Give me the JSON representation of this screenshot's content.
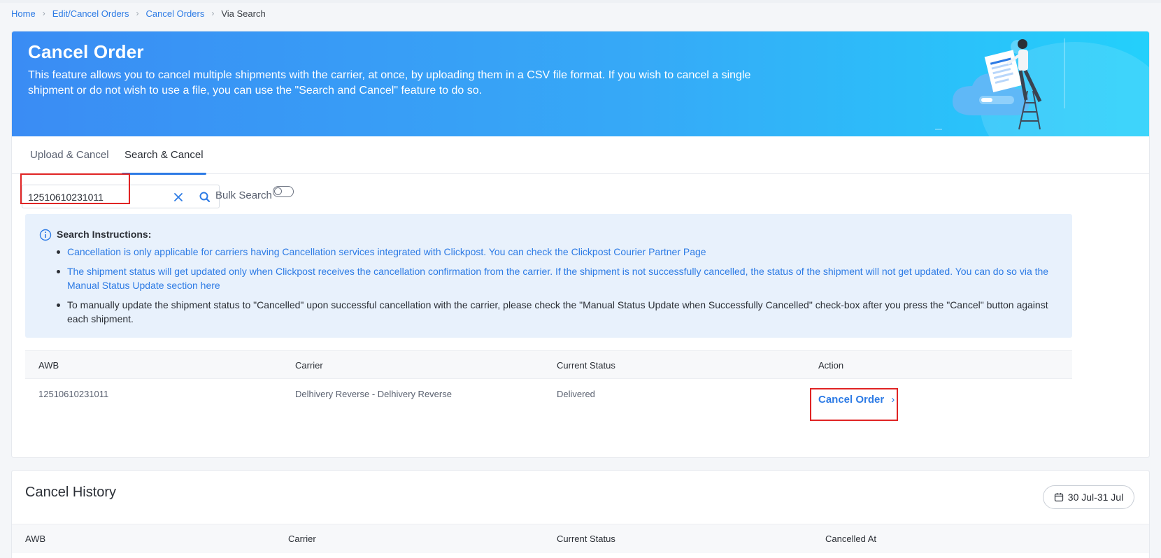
{
  "breadcrumb": {
    "items": [
      "Home",
      "Edit/Cancel Orders",
      "Cancel Orders"
    ],
    "current": "Via Search"
  },
  "banner": {
    "title": "Cancel Order",
    "description": "This feature allows you to cancel multiple shipments with the carrier, at once, by uploading them in a CSV file format. If you wish to cancel a single shipment or do not wish to use a file, you can use the \"Search and Cancel\" feature to do so."
  },
  "tabs": [
    {
      "label": "Upload & Cancel",
      "active": false
    },
    {
      "label": "Search & Cancel",
      "active": true
    }
  ],
  "search": {
    "value": "12510610231011",
    "bulk_label": "Bulk Search",
    "bulk_enabled": false
  },
  "instructions": {
    "title": "Search Instructions:",
    "items": [
      "Cancellation is only applicable for carriers having Cancellation services integrated with Clickpost. You can check the Clickpost Courier Partner Page",
      "The shipment status will get updated only when Clickpost receives the cancellation confirmation from the carrier. If the shipment is not successfully cancelled, the status of the shipment will not get updated. You can do so via the Manual Status Update section here",
      "To manually update the shipment status to \"Cancelled\" upon successful cancellation with the carrier, please check the \"Manual Status Update when Successfully Cancelled\" check-box after you press the \"Cancel\" button against each shipment."
    ]
  },
  "results_table": {
    "headers": [
      "AWB",
      "Carrier",
      "Current Status",
      "Action"
    ],
    "rows": [
      {
        "awb": "12510610231011",
        "carrier": "Delhivery Reverse - Delhivery Reverse",
        "status": "Delivered",
        "action": "Cancel Order"
      }
    ]
  },
  "history": {
    "title": "Cancel History",
    "date_range": "30 Jul-31 Jul",
    "headers": [
      "AWB",
      "Carrier",
      "Current Status",
      "Cancelled At"
    ]
  },
  "colors": {
    "accent": "#2d7be5",
    "highlight": "#e02424",
    "banner_start": "#3a8cf4",
    "banner_end": "#23d0fb",
    "instructions_bg": "#e8f1fc"
  }
}
